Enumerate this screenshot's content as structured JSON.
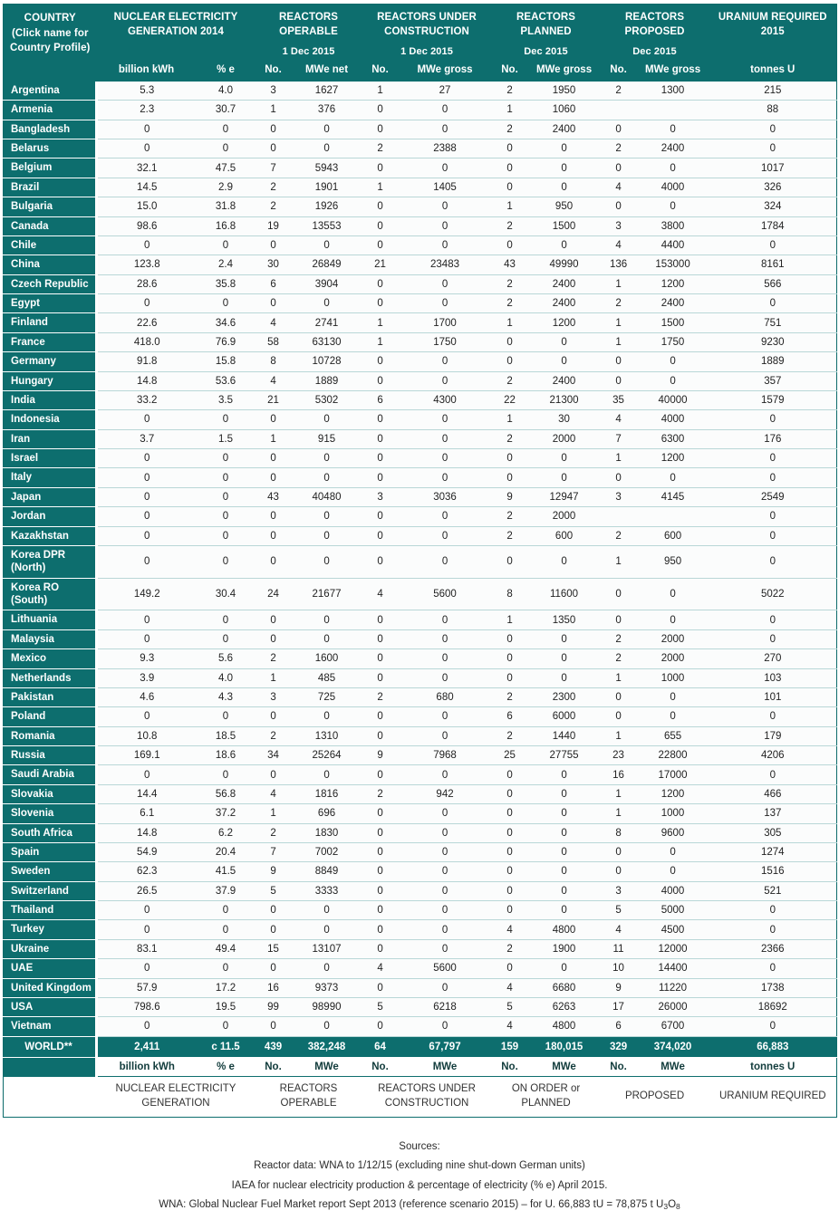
{
  "header": {
    "country": {
      "title": "COUNTRY",
      "note": "(Click name for Country Profile)"
    },
    "groups": [
      {
        "title": "NUCLEAR ELECTRICITY GENERATION 2014",
        "date": ""
      },
      {
        "title": "REACTORS OPERABLE",
        "date": "1 Dec 2015"
      },
      {
        "title": "REACTORS UNDER CONSTRUCTION",
        "date": "1 Dec 2015"
      },
      {
        "title": "REACTORS PLANNED",
        "date": "Dec 2015"
      },
      {
        "title": "REACTORS PROPOSED",
        "date": "Dec 2015"
      },
      {
        "title": "URANIUM REQUIRED 2015",
        "date": ""
      }
    ],
    "units": [
      "billion kWh",
      "% e",
      "No.",
      "MWe net",
      "No.",
      "MWe gross",
      "No.",
      "MWe gross",
      "No.",
      "MWe gross",
      "tonnes U"
    ]
  },
  "chart_data": {
    "type": "table",
    "title": "World Nuclear Power Reactors & Uranium Requirements",
    "columns": [
      "COUNTRY",
      "billion kWh",
      "% e",
      "No.",
      "MWe net",
      "No.",
      "MWe gross",
      "No.",
      "MWe gross",
      "No.",
      "MWe gross",
      "tonnes U"
    ],
    "rows": [
      {
        "country": "Argentina",
        "tall": false,
        "cells": [
          "5.3",
          "4.0",
          "3",
          "1627",
          "1",
          "27",
          "2",
          "1950",
          "2",
          "1300",
          "215"
        ]
      },
      {
        "country": "Armenia",
        "tall": false,
        "cells": [
          "2.3",
          "30.7",
          "1",
          "376",
          "0",
          "0",
          "1",
          "1060",
          "",
          "",
          "88"
        ]
      },
      {
        "country": "Bangladesh",
        "tall": false,
        "cells": [
          "0",
          "0",
          "0",
          "0",
          "0",
          "0",
          "2",
          "2400",
          "0",
          "0",
          "0"
        ]
      },
      {
        "country": "Belarus",
        "tall": false,
        "cells": [
          "0",
          "0",
          "0",
          "0",
          "2",
          "2388",
          "0",
          "0",
          "2",
          "2400",
          "0"
        ]
      },
      {
        "country": "Belgium",
        "tall": false,
        "cells": [
          "32.1",
          "47.5",
          "7",
          "5943",
          "0",
          "0",
          "0",
          "0",
          "0",
          "0",
          "1017"
        ]
      },
      {
        "country": "Brazil",
        "tall": false,
        "cells": [
          "14.5",
          "2.9",
          "2",
          "1901",
          "1",
          "1405",
          "0",
          "0",
          "4",
          "4000",
          "326"
        ]
      },
      {
        "country": "Bulgaria",
        "tall": false,
        "cells": [
          "15.0",
          "31.8",
          "2",
          "1926",
          "0",
          "0",
          "1",
          "950",
          "0",
          "0",
          "324"
        ]
      },
      {
        "country": "Canada",
        "tall": false,
        "cells": [
          "98.6",
          "16.8",
          "19",
          "13553",
          "0",
          "0",
          "2",
          "1500",
          "3",
          "3800",
          "1784"
        ]
      },
      {
        "country": "Chile",
        "tall": false,
        "cells": [
          "0",
          "0",
          "0",
          "0",
          "0",
          "0",
          "0",
          "0",
          "4",
          "4400",
          "0"
        ]
      },
      {
        "country": "China",
        "tall": false,
        "cells": [
          "123.8",
          "2.4",
          "30",
          "26849",
          "21",
          "23483",
          "43",
          "49990",
          "136",
          "153000",
          "8161"
        ]
      },
      {
        "country": "Czech Republic",
        "tall": true,
        "cells": [
          "28.6",
          "35.8",
          "6",
          "3904",
          "0",
          "0",
          "2",
          "2400",
          "1",
          "1200",
          "566"
        ]
      },
      {
        "country": "Egypt",
        "tall": false,
        "cells": [
          "0",
          "0",
          "0",
          "0",
          "0",
          "0",
          "2",
          "2400",
          "2",
          "2400",
          "0"
        ]
      },
      {
        "country": "Finland",
        "tall": false,
        "cells": [
          "22.6",
          "34.6",
          "4",
          "2741",
          "1",
          "1700",
          "1",
          "1200",
          "1",
          "1500",
          "751"
        ]
      },
      {
        "country": "France",
        "tall": false,
        "cells": [
          "418.0",
          "76.9",
          "58",
          "63130",
          "1",
          "1750",
          "0",
          "0",
          "1",
          "1750",
          "9230"
        ]
      },
      {
        "country": "Germany",
        "tall": false,
        "cells": [
          "91.8",
          "15.8",
          "8",
          "10728",
          "0",
          "0",
          "0",
          "0",
          "0",
          "0",
          "1889"
        ]
      },
      {
        "country": "Hungary",
        "tall": false,
        "cells": [
          "14.8",
          "53.6",
          "4",
          "1889",
          "0",
          "0",
          "2",
          "2400",
          "0",
          "0",
          "357"
        ]
      },
      {
        "country": "India",
        "tall": false,
        "cells": [
          "33.2",
          "3.5",
          "21",
          "5302",
          "6",
          "4300",
          "22",
          "21300",
          "35",
          "40000",
          "1579"
        ]
      },
      {
        "country": "Indonesia",
        "tall": false,
        "cells": [
          "0",
          "0",
          "0",
          "0",
          "0",
          "0",
          "1",
          "30",
          "4",
          "4000",
          "0"
        ]
      },
      {
        "country": "Iran",
        "tall": false,
        "cells": [
          "3.7",
          "1.5",
          "1",
          "915",
          "0",
          "0",
          "2",
          "2000",
          "7",
          "6300",
          "176"
        ]
      },
      {
        "country": "Israel",
        "tall": false,
        "cells": [
          "0",
          "0",
          "0",
          "0",
          "0",
          "0",
          "0",
          "0",
          "1",
          "1200",
          "0"
        ]
      },
      {
        "country": "Italy",
        "tall": false,
        "cells": [
          "0",
          "0",
          "0",
          "0",
          "0",
          "0",
          "0",
          "0",
          "0",
          "0",
          "0"
        ]
      },
      {
        "country": "Japan",
        "tall": false,
        "cells": [
          "0",
          "0",
          "43",
          "40480",
          "3",
          "3036",
          "9",
          "12947",
          "3",
          "4145",
          "2549"
        ]
      },
      {
        "country": "Jordan",
        "tall": false,
        "cells": [
          "0",
          "0",
          "0",
          "0",
          "0",
          "0",
          "2",
          "2000",
          "",
          "",
          "0"
        ]
      },
      {
        "country": "Kazakhstan",
        "tall": false,
        "cells": [
          "0",
          "0",
          "0",
          "0",
          "0",
          "0",
          "2",
          "600",
          "2",
          "600",
          "0"
        ]
      },
      {
        "country": "Korea DPR (North)",
        "tall": true,
        "cells": [
          "0",
          "0",
          "0",
          "0",
          "0",
          "0",
          "0",
          "0",
          "1",
          "950",
          "0"
        ]
      },
      {
        "country": "Korea RO (South)",
        "tall": true,
        "cells": [
          "149.2",
          "30.4",
          "24",
          "21677",
          "4",
          "5600",
          "8",
          "11600",
          "0",
          "0",
          "5022"
        ]
      },
      {
        "country": "Lithuania",
        "tall": false,
        "cells": [
          "0",
          "0",
          "0",
          "0",
          "0",
          "0",
          "1",
          "1350",
          "0",
          "0",
          "0"
        ]
      },
      {
        "country": "Malaysia",
        "tall": false,
        "cells": [
          "0",
          "0",
          "0",
          "0",
          "0",
          "0",
          "0",
          "0",
          "2",
          "2000",
          "0"
        ]
      },
      {
        "country": "Mexico",
        "tall": false,
        "cells": [
          "9.3",
          "5.6",
          "2",
          "1600",
          "0",
          "0",
          "0",
          "0",
          "2",
          "2000",
          "270"
        ]
      },
      {
        "country": "Netherlands",
        "tall": false,
        "cells": [
          "3.9",
          "4.0",
          "1",
          "485",
          "0",
          "0",
          "0",
          "0",
          "1",
          "1000",
          "103"
        ]
      },
      {
        "country": "Pakistan",
        "tall": false,
        "cells": [
          "4.6",
          "4.3",
          "3",
          "725",
          "2",
          "680",
          "2",
          "2300",
          "0",
          "0",
          "101"
        ]
      },
      {
        "country": "Poland",
        "tall": false,
        "cells": [
          "0",
          "0",
          "0",
          "0",
          "0",
          "0",
          "6",
          "6000",
          "0",
          "0",
          "0"
        ]
      },
      {
        "country": "Romania",
        "tall": false,
        "cells": [
          "10.8",
          "18.5",
          "2",
          "1310",
          "0",
          "0",
          "2",
          "1440",
          "1",
          "655",
          "179"
        ]
      },
      {
        "country": "Russia",
        "tall": false,
        "cells": [
          "169.1",
          "18.6",
          "34",
          "25264",
          "9",
          "7968",
          "25",
          "27755",
          "23",
          "22800",
          "4206"
        ]
      },
      {
        "country": "Saudi Arabia",
        "tall": false,
        "cells": [
          "0",
          "0",
          "0",
          "0",
          "0",
          "0",
          "0",
          "0",
          "16",
          "17000",
          "0"
        ]
      },
      {
        "country": "Slovakia",
        "tall": false,
        "cells": [
          "14.4",
          "56.8",
          "4",
          "1816",
          "2",
          "942",
          "0",
          "0",
          "1",
          "1200",
          "466"
        ]
      },
      {
        "country": "Slovenia",
        "tall": false,
        "cells": [
          "6.1",
          "37.2",
          "1",
          "696",
          "0",
          "0",
          "0",
          "0",
          "1",
          "1000",
          "137"
        ]
      },
      {
        "country": "South Africa",
        "tall": false,
        "cells": [
          "14.8",
          "6.2",
          "2",
          "1830",
          "0",
          "0",
          "0",
          "0",
          "8",
          "9600",
          "305"
        ]
      },
      {
        "country": "Spain",
        "tall": false,
        "cells": [
          "54.9",
          "20.4",
          "7",
          "7002",
          "0",
          "0",
          "0",
          "0",
          "0",
          "0",
          "1274"
        ]
      },
      {
        "country": "Sweden",
        "tall": false,
        "cells": [
          "62.3",
          "41.5",
          "9",
          "8849",
          "0",
          "0",
          "0",
          "0",
          "0",
          "0",
          "1516"
        ]
      },
      {
        "country": "Switzerland",
        "tall": false,
        "cells": [
          "26.5",
          "37.9",
          "5",
          "3333",
          "0",
          "0",
          "0",
          "0",
          "3",
          "4000",
          "521"
        ]
      },
      {
        "country": "Thailand",
        "tall": false,
        "cells": [
          "0",
          "0",
          "0",
          "0",
          "0",
          "0",
          "0",
          "0",
          "5",
          "5000",
          "0"
        ]
      },
      {
        "country": "Turkey",
        "tall": false,
        "cells": [
          "0",
          "0",
          "0",
          "0",
          "0",
          "0",
          "4",
          "4800",
          "4",
          "4500",
          "0"
        ]
      },
      {
        "country": "Ukraine",
        "tall": false,
        "cells": [
          "83.1",
          "49.4",
          "15",
          "13107",
          "0",
          "0",
          "2",
          "1900",
          "11",
          "12000",
          "2366"
        ]
      },
      {
        "country": "UAE",
        "tall": false,
        "cells": [
          "0",
          "0",
          "0",
          "0",
          "4",
          "5600",
          "0",
          "0",
          "10",
          "14400",
          "0"
        ]
      },
      {
        "country": "United Kingdom",
        "tall": true,
        "cells": [
          "57.9",
          "17.2",
          "16",
          "9373",
          "0",
          "0",
          "4",
          "6680",
          "9",
          "11220",
          "1738"
        ]
      },
      {
        "country": "USA",
        "tall": false,
        "cells": [
          "798.6",
          "19.5",
          "99",
          "98990",
          "5",
          "6218",
          "5",
          "6263",
          "17",
          "26000",
          "18692"
        ]
      },
      {
        "country": "Vietnam",
        "tall": false,
        "cells": [
          "0",
          "0",
          "0",
          "0",
          "0",
          "0",
          "4",
          "4800",
          "6",
          "6700",
          "0"
        ]
      }
    ],
    "total_row": {
      "label": "WORLD**",
      "cells": [
        "2,411",
        "c 11.5",
        "439",
        "382,248",
        "64",
        "67,797",
        "159",
        "180,015",
        "329",
        "374,020",
        "66,883"
      ]
    },
    "footer_units": [
      "billion kWh",
      "% e",
      "No.",
      "MWe",
      "No.",
      "MWe",
      "No.",
      "MWe",
      "No.",
      "MWe",
      "tonnes U"
    ],
    "footer_groups": [
      "NUCLEAR ELECTRICITY GENERATION",
      "REACTORS OPERABLE",
      "REACTORS UNDER CONSTRUCTION",
      "ON ORDER or PLANNED",
      "PROPOSED",
      "URANIUM REQUIRED"
    ]
  },
  "sources": {
    "heading": "Sources:",
    "line1": "Reactor data: WNA to 1/12/15 (excluding nine shut-down German units)",
    "line2": "IAEA for nuclear electricity production & percentage of electricity (% e) April 2015.",
    "line3_a": "WNA: Global Nuclear Fuel Market report Sept 2013 (reference scenario 2015) – for U. 66,883 tU = 78,875 t U",
    "line3_sub1": "3",
    "line3_b": "O",
    "line3_sub2": "8"
  },
  "colors": {
    "teal": "#0d6e6e",
    "teal_dark": "#123c3c",
    "row_bg": "#fbfcfc",
    "row_border": "#b9d7d7"
  }
}
